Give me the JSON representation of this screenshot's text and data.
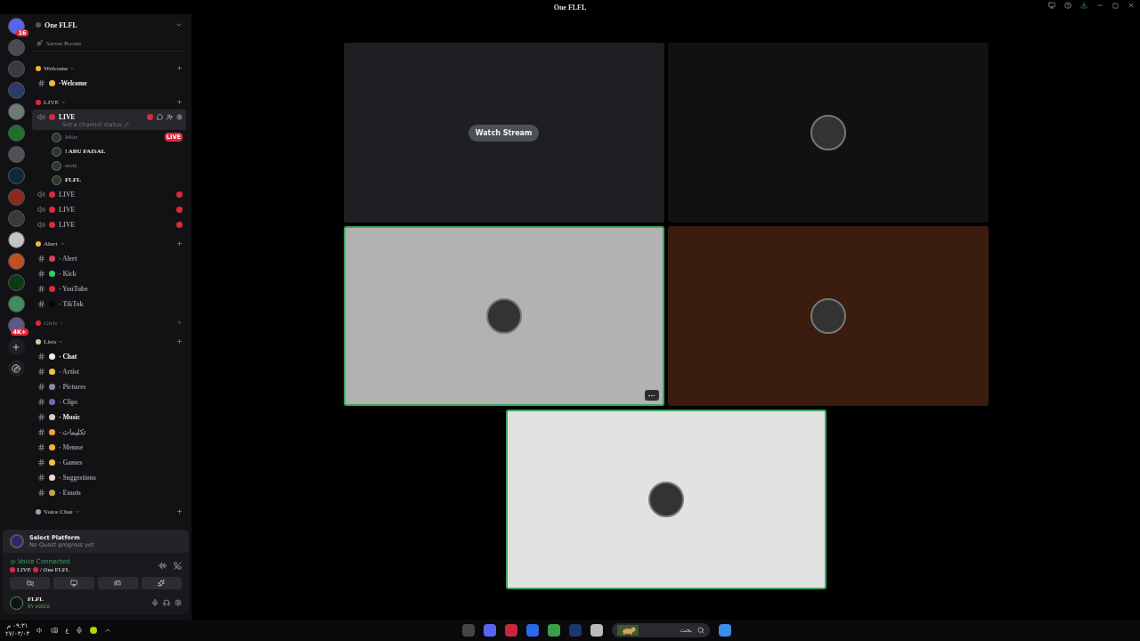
{
  "title_bar": {
    "title": "One FLFL"
  },
  "rail": {
    "servers": [
      {
        "color": "#5865f2",
        "badge": "16"
      },
      {
        "color": "#4a4a50"
      },
      {
        "color": "#3a3a40"
      },
      {
        "color": "#2b3a6b"
      },
      {
        "color": "#6f7a78"
      },
      {
        "color": "#1f6f2e"
      },
      {
        "color": "#505058"
      },
      {
        "color": "#0f2a3a"
      },
      {
        "color": "#8a2a1a"
      },
      {
        "color": "#3a3a3a"
      },
      {
        "color": "#c4c4c4"
      },
      {
        "color": "#c05020"
      },
      {
        "color": "#0c3a14"
      },
      {
        "color": "#3f8c5c"
      },
      {
        "color": "#5a5a8a",
        "badge": "4K+"
      }
    ]
  },
  "server": {
    "name": "One FLFL",
    "boosts": "Server Boosts"
  },
  "categories": [
    {
      "name": "Welcome",
      "color": "#f2b53a",
      "collapsed": false,
      "channels": [
        {
          "kind": "text",
          "name": "-Welcome",
          "color": "#f2b53a",
          "unread": true,
          "selected": false
        }
      ]
    },
    {
      "name": "LIVE",
      "color": "#e0283c",
      "collapsed": false,
      "channels": [
        {
          "kind": "voice",
          "name": "LIVE",
          "color": "#e0283c",
          "unread": true,
          "selected": true,
          "status": "Set a channel status",
          "members": [
            {
              "name": "Mörr",
              "bold": false,
              "badge": "LIVE"
            },
            {
              "name": "! ABU FAISAL",
              "bold": true
            },
            {
              "name": "endx",
              "bold": false
            },
            {
              "name": "FLFL",
              "bold": true
            }
          ]
        },
        {
          "kind": "voice",
          "name": "LIVE",
          "color": "#e0283c",
          "unread": false,
          "selected": false
        },
        {
          "kind": "voice",
          "name": "LIVE",
          "color": "#e0283c",
          "unread": false,
          "selected": false
        },
        {
          "kind": "voice",
          "name": "LIVE",
          "color": "#e0283c",
          "unread": false,
          "selected": false
        }
      ]
    },
    {
      "name": "Alert",
      "color": "#f2b53a",
      "collapsed": false,
      "channels": [
        {
          "kind": "text",
          "name": "· Alert",
          "color": "#d8405a",
          "unread": false,
          "selected": false
        },
        {
          "kind": "text",
          "name": "· Kick",
          "color": "#2bd55a",
          "unread": false,
          "selected": false
        },
        {
          "kind": "text",
          "name": "· YouTube",
          "color": "#e0283c",
          "unread": false,
          "selected": false
        },
        {
          "kind": "text",
          "name": "· TikTok",
          "color": "#050505",
          "unread": false,
          "selected": false
        }
      ]
    },
    {
      "name": "Girls",
      "color": "#e0283c",
      "collapsed": true
    },
    {
      "name": "Lists",
      "color": "#d9c6a0",
      "collapsed": false,
      "channels": [
        {
          "kind": "text",
          "name": "· Chat",
          "color": "#f0f0f0",
          "unread": true,
          "selected": false
        },
        {
          "kind": "text",
          "name": "· Artist",
          "color": "#f2c53a",
          "unread": false,
          "selected": false
        },
        {
          "kind": "text",
          "name": "· Pictures",
          "color": "#8a8aa8",
          "unread": false,
          "selected": false
        },
        {
          "kind": "text",
          "name": "· Clips",
          "color": "#6a6ab8",
          "unread": false,
          "selected": false
        },
        {
          "kind": "text",
          "name": "· Music",
          "color": "#cfcfcf",
          "unread": true,
          "selected": false
        },
        {
          "kind": "text",
          "name": "· تكليمات",
          "color": "#f2a23a",
          "unread": false,
          "selected": false
        },
        {
          "kind": "text",
          "name": "· Memse",
          "color": "#f2b53a",
          "unread": false,
          "selected": false
        },
        {
          "kind": "text",
          "name": "· Games",
          "color": "#f2c53a",
          "unread": false,
          "selected": false
        },
        {
          "kind": "text",
          "name": "· Suggestions",
          "color": "#e8e0d0",
          "unread": false,
          "selected": false
        },
        {
          "kind": "text",
          "name": "· Emots",
          "color": "#c8a050",
          "unread": false,
          "selected": false
        }
      ]
    },
    {
      "name": "Voice Chat",
      "color": "#9aa0a8",
      "collapsed": false
    }
  ],
  "quest": {
    "title": "Select Platform",
    "subtitle": "No Quest progress yet"
  },
  "voice": {
    "status": "Voice Connected",
    "channel": "LIVE",
    "server": "/ One FLFL"
  },
  "user": {
    "name": "FLFL",
    "status": "In voice"
  },
  "tiles": [
    {
      "kind": "stream",
      "color": "#1e1f22",
      "speaking": false,
      "show_menu": false,
      "button": "Watch Stream"
    },
    {
      "kind": "user",
      "color": "#111111",
      "speaking": false,
      "show_menu": false
    },
    {
      "kind": "user",
      "color": "#b2b2b2",
      "speaking": true,
      "show_menu": true
    },
    {
      "kind": "user",
      "color": "#3a1d0e",
      "speaking": false,
      "show_menu": false
    },
    {
      "kind": "user",
      "color": "#e2e2e2",
      "speaking": true,
      "show_menu": false
    }
  ],
  "taskbar": {
    "clock_time": "٠٩:٣١ م",
    "clock_date": "٢٧/٠٣/٠٣",
    "language": "ع",
    "search_placeholder": "بحث"
  }
}
